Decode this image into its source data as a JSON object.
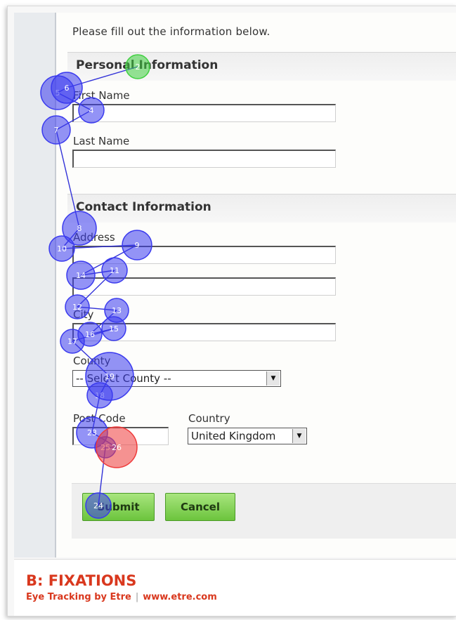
{
  "form": {
    "intro": "Please fill out the information below.",
    "personal_title": "Personal Information",
    "first_name_label": "First Name",
    "last_name_label": "Last Name",
    "contact_title": "Contact Information",
    "address_label": "Address",
    "city_label": "City",
    "county_label": "County",
    "county_value": "-- Select County --",
    "post_code_label": "Post Code",
    "country_label": "Country",
    "country_value": "United Kingdom",
    "submit_label": "Submit",
    "cancel_label": "Cancel"
  },
  "footer": {
    "title": "B: FIXATIONS",
    "brand": "Eye Tracking by Etre",
    "separator": "|",
    "url": "www.etre.com"
  },
  "fixations": [
    {
      "id": "2",
      "color": "#40d040"
    },
    {
      "id": "4"
    },
    {
      "id": "5"
    },
    {
      "id": "6"
    },
    {
      "id": "7"
    },
    {
      "id": "8"
    },
    {
      "id": "9"
    },
    {
      "id": "10"
    },
    {
      "id": "11"
    },
    {
      "id": "12"
    },
    {
      "id": "13"
    },
    {
      "id": "14"
    },
    {
      "id": "15"
    },
    {
      "id": "16"
    },
    {
      "id": "17"
    },
    {
      "id": "18"
    },
    {
      "id": "19"
    },
    {
      "id": "23"
    },
    {
      "id": "24"
    },
    {
      "id": "25"
    },
    {
      "id": "26",
      "color": "#ef3a3a"
    }
  ],
  "colors": {
    "fixation": "#3a3aee",
    "start": "#40d040",
    "end": "#ef3a3a",
    "brand": "#d9381e",
    "button": "#7ccc4a"
  }
}
